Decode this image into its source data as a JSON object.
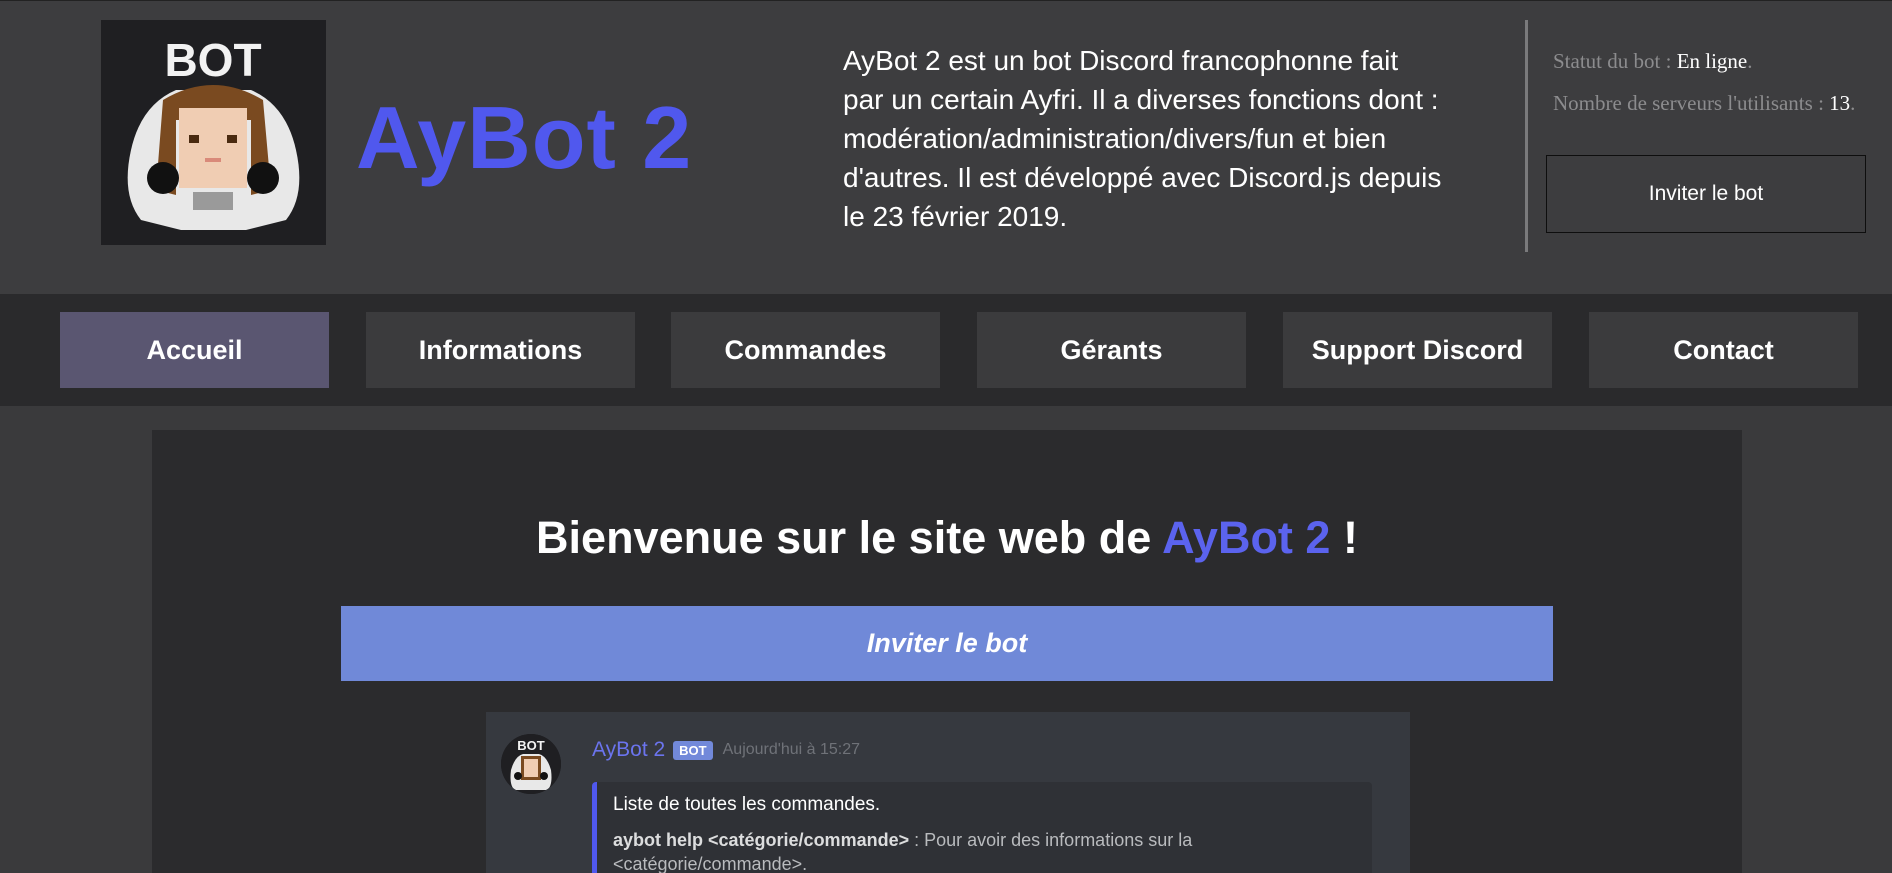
{
  "header": {
    "logo_text": "BOT",
    "brand": "AyBot 2",
    "description": "AyBot 2 est un bot Discord francophonne fait par un certain Ayfri. Il a diverses fonctions dont : modération/administration/divers/fun et bien d'autres. Il est développé avec Discord.js depuis le 23 février 2019.",
    "status_label": "Statut du bot : ",
    "status_value": "En ligne",
    "servers_label": "Nombre de serveurs l'utilisants : ",
    "servers_value": "13",
    "invite_button": "Inviter le bot"
  },
  "nav": {
    "items": [
      {
        "label": "Accueil"
      },
      {
        "label": "Informations"
      },
      {
        "label": "Commandes"
      },
      {
        "label": "Gérants"
      },
      {
        "label": "Support Discord"
      },
      {
        "label": "Contact"
      }
    ]
  },
  "main": {
    "welcome_prefix": "Bienvenue sur le site web de ",
    "welcome_accent": "AyBot 2",
    "welcome_suffix": " !",
    "invite_bar": "Inviter le bot",
    "message": {
      "author": "AyBot 2",
      "tag": "BOT",
      "time": "Aujourd'hui à 15:27",
      "avatar_text": "BOT",
      "embed_title": "Liste de toutes les commandes.",
      "embed_cmd": "aybot help <catégorie/commande>",
      "embed_desc": " : Pour avoir des informations sur la <catégorie/commande>."
    }
  },
  "colors": {
    "accent": "#5058ee",
    "invite_bar": "#7089d8",
    "nav_active": "#5a5671",
    "discord_bg": "#36393f",
    "embed_border": "#5058ee"
  }
}
